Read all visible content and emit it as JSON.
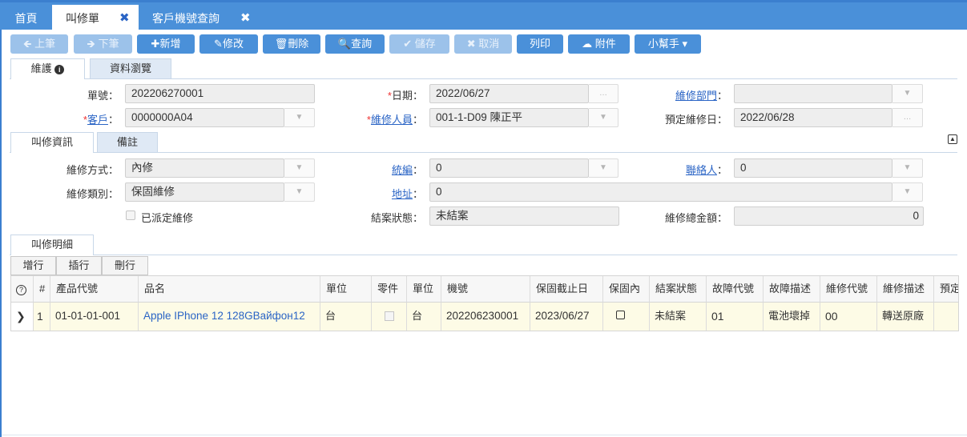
{
  "tabs": {
    "home": "首頁",
    "repair": "叫修單",
    "query": "客戶機號查詢"
  },
  "toolbar": {
    "prev": "上筆",
    "next": "下筆",
    "add": "新增",
    "edit": "修改",
    "del": "刪除",
    "query": "查詢",
    "save": "儲存",
    "cancel": "取消",
    "print": "列印",
    "attach": "附件",
    "helper": "小幫手"
  },
  "maintab": {
    "maint": "維護",
    "browse": "資料瀏覽"
  },
  "header": {
    "no_label": "單號：",
    "no": "202206270001",
    "date_label": "日期",
    "date": "2022/06/27",
    "dept_label": "維修部門",
    "cust_label": "客戶",
    "cust": "0000000A04",
    "staff_label": "維修人員",
    "staff": "001-1-D09 陳正平",
    "sched_label": "預定維修日：",
    "sched": "2022/06/28"
  },
  "infotab": {
    "info": "叫修資訊",
    "memo": "備註"
  },
  "info": {
    "method_label": "維修方式：",
    "method": "內修",
    "taxid_label": "統編",
    "taxid": "0",
    "contact_label": "聯絡人",
    "contact": "0",
    "type_label": "維修類別：",
    "type": "保固維修",
    "addr_label": "地址",
    "addr": "0",
    "dispatched_label": "已派定維修",
    "status_label": "結案狀態：",
    "status": "未結案",
    "total_label": "維修總金額：",
    "total": "0"
  },
  "detail": {
    "tab": "叫修明細",
    "add": "增行",
    "insert": "插行",
    "delete": "刪行"
  },
  "grid": {
    "headers": [
      "#",
      "產品代號",
      "品名",
      "單位",
      "零件",
      "單位",
      "機號",
      "保固截止日",
      "保固內",
      "結案狀態",
      "故障代號",
      "故障描述",
      "維修代號",
      "維修描述",
      "預定"
    ],
    "row": {
      "n": "1",
      "code": "01-01-01-001",
      "name": "Apple IPhone 12 128GBайфон12",
      "unit": "台",
      "unit2": "台",
      "serial": "202206230001",
      "warranty": "2023/06/27",
      "status": "未結案",
      "fault": "01",
      "fault_desc": "電池壞掉",
      "rep_code": "00",
      "rep_desc": "轉送原廠"
    }
  }
}
